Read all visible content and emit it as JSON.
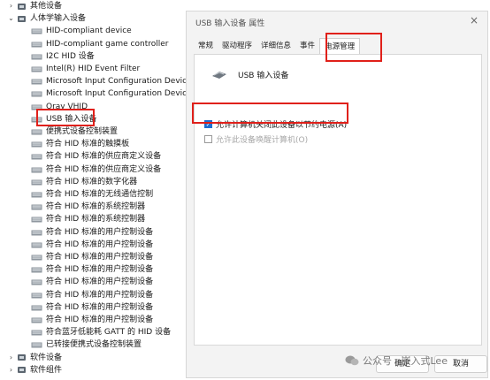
{
  "tree": {
    "top": [
      {
        "label": "其他设备",
        "arrow": "›",
        "icon": "unknown-device-icon"
      },
      {
        "label": "人体学输入设备",
        "arrow": "⌄",
        "icon": "hid-category-icon"
      }
    ],
    "children": [
      "HID-compliant device",
      "HID-compliant game controller",
      "I2C HID 设备",
      "Intel(R) HID Event Filter",
      "Microsoft Input Configuration Device",
      "Microsoft Input Configuration Device",
      "Oray VHID",
      "USB 输入设备",
      "便携式设备控制装置",
      "符合 HID 标准的触摸板",
      "符合 HID 标准的供应商定义设备",
      "符合 HID 标准的供应商定义设备",
      "符合 HID 标准的数字化器",
      "符合 HID 标准的无线通信控制",
      "符合 HID 标准的系统控制器",
      "符合 HID 标准的系统控制器",
      "符合 HID 标准的用户控制设备",
      "符合 HID 标准的用户控制设备",
      "符合 HID 标准的用户控制设备",
      "符合 HID 标准的用户控制设备",
      "符合 HID 标准的用户控制设备",
      "符合 HID 标准的用户控制设备",
      "符合 HID 标准的用户控制设备",
      "符合 HID 标准的用户控制设备",
      "符合蓝牙低能耗 GATT 的 HID 设备",
      "已转接便携式设备控制装置"
    ],
    "bottom": [
      {
        "label": "软件设备",
        "arrow": "›",
        "icon": "software-device-icon"
      },
      {
        "label": "软件组件",
        "arrow": "›",
        "icon": "software-component-icon"
      }
    ]
  },
  "dialog": {
    "title": "USB 输入设备 属性",
    "close": "×",
    "tabs": [
      "常规",
      "驱动程序",
      "详细信息",
      "事件",
      "电源管理"
    ],
    "active_tab": "电源管理",
    "device_name": "USB 输入设备",
    "option1": "允许计算机关闭此设备以节约电源(A)",
    "option1_checked": true,
    "option2": "允许此设备唤醒计算机(O)",
    "option2_checked": false,
    "ok": "确定",
    "cancel": "取消"
  },
  "watermark": "公众号 · 嵌入式Lee",
  "colors": {
    "highlight": "#e0201a",
    "checkbox": "#1f6fd1"
  }
}
